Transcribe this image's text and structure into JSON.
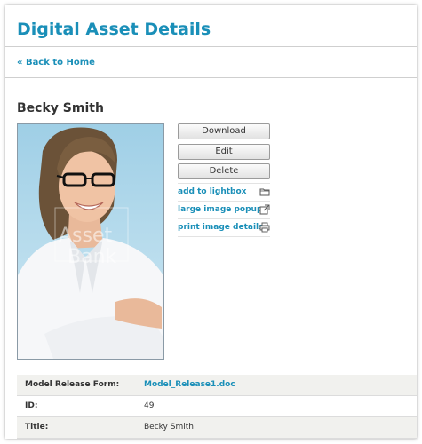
{
  "page": {
    "title": "Digital Asset Details",
    "back_link": "« Back to Home"
  },
  "asset": {
    "name": "Becky Smith",
    "watermark": "AssetBank"
  },
  "buttons": {
    "download": "Download",
    "edit": "Edit",
    "delete": "Delete"
  },
  "actions": [
    {
      "label": "add to lightbox",
      "icon": "folder-icon"
    },
    {
      "label": "large image popup",
      "icon": "popup-icon"
    },
    {
      "label": "print image details",
      "icon": "printer-icon"
    }
  ],
  "details": [
    {
      "key": "Model Release Form:",
      "value": "Model_Release1.doc",
      "is_link": true
    },
    {
      "key": "ID:",
      "value": "49",
      "is_link": false
    },
    {
      "key": "Title:",
      "value": "Becky Smith",
      "is_link": false
    }
  ],
  "colors": {
    "accent": "#1a8fb8",
    "row_alt": "#f1f1ee"
  }
}
